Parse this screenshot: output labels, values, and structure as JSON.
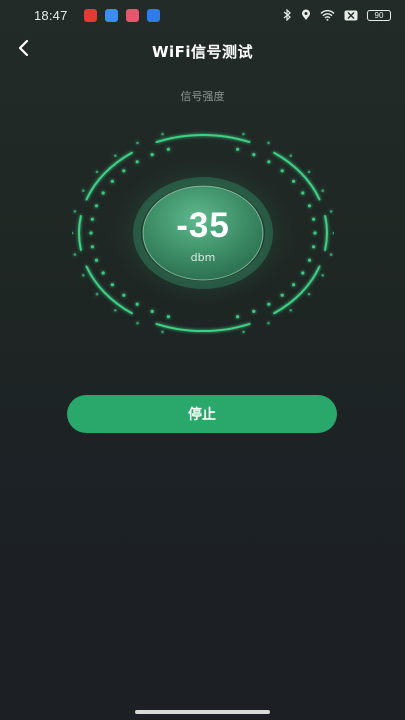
{
  "status_bar": {
    "time": "18:47",
    "notification_icons": [
      {
        "name": "red-app-icon",
        "color": "#e53935"
      },
      {
        "name": "blue-chat-icon",
        "color": "#3d8df0"
      },
      {
        "name": "pink-app-icon",
        "color": "#e8556c"
      },
      {
        "name": "blue-loop-icon",
        "color": "#2f7be8"
      }
    ],
    "system_icons": [
      "bluetooth-icon",
      "location-icon",
      "wifi-icon",
      "no-sim-icon"
    ],
    "battery": "90"
  },
  "header": {
    "back_icon": "chevron-left-icon",
    "title": "WiFi信号测试"
  },
  "subtitle": "信号强度",
  "gauge": {
    "value": "-35",
    "unit": "dbm",
    "accent_color": "#3fdc8c"
  },
  "stop_button": {
    "label": "停止",
    "color": "#2aa76a"
  }
}
